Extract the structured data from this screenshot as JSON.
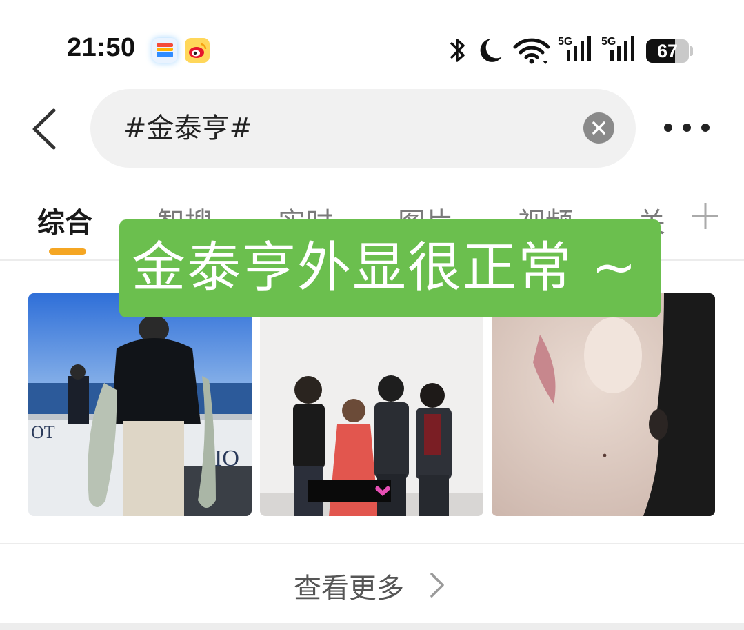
{
  "status_bar": {
    "time": "21:50",
    "battery_level": "67",
    "battery_fraction": 0.67,
    "network_label_1": "5G",
    "network_label_2": "5G",
    "icons": [
      "wallet-app-icon",
      "weibo-app-icon",
      "bluetooth-icon",
      "do-not-disturb-moon-icon",
      "wifi-icon",
      "cellular-signal-icon",
      "cellular-signal-icon",
      "battery-icon"
    ]
  },
  "header": {
    "back_icon": "chevron-left-icon",
    "search_value": "#金泰亨#",
    "clear_icon": "close-circle-icon",
    "more_icon": "more-dots-icon"
  },
  "tabs": {
    "items": [
      {
        "label": "综合",
        "active": true
      },
      {
        "label": "智搜",
        "active": false
      },
      {
        "label": "实时",
        "active": false
      },
      {
        "label": "图片",
        "active": false
      },
      {
        "label": "视频",
        "active": false
      },
      {
        "label": "关",
        "active": false
      }
    ],
    "add_icon": "plus-icon",
    "accent_color": "#f5a623"
  },
  "caption": {
    "text": "金泰亨外显很正常 ~",
    "background": "#6bbf4e"
  },
  "photos": [
    {
      "description_icon": "photo-man-holding-fish"
    },
    {
      "description_icon": "photo-group-of-four"
    },
    {
      "description_icon": "photo-face-closeup"
    }
  ],
  "view_more": {
    "label": "查看更多",
    "icon": "chevron-right-icon"
  }
}
